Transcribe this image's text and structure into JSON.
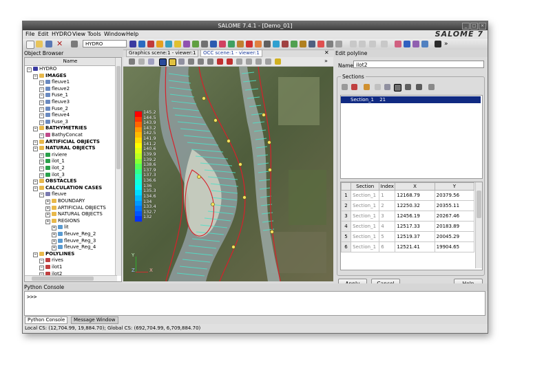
{
  "window": {
    "title": "SALOME 7.4.1 - [Demo_01]",
    "brand": "SALOME 7",
    "win_buttons": [
      "_",
      "□",
      "×"
    ]
  },
  "menubar": {
    "items": [
      "File",
      "Edit",
      "HYDRO",
      "View",
      "Tools",
      "Window",
      "Help"
    ]
  },
  "toolbar": {
    "module_combo": "HYDRO"
  },
  "object_browser": {
    "title": "Object Browser",
    "column_header": "Name",
    "tree": [
      {
        "label": "HYDRO",
        "depth": 0,
        "bold": false,
        "icon": "hydro-root-icon"
      },
      {
        "label": "IMAGES",
        "depth": 1,
        "bold": true,
        "icon": "folder-icon"
      },
      {
        "label": "fleuve1",
        "depth": 2,
        "bold": false,
        "icon": "image-icon"
      },
      {
        "label": "fleuve2",
        "depth": 2,
        "bold": false,
        "icon": "image-icon"
      },
      {
        "label": "Fuse_1",
        "depth": 2,
        "bold": false,
        "icon": "image-icon"
      },
      {
        "label": "fleuve3",
        "depth": 2,
        "bold": false,
        "icon": "image-icon"
      },
      {
        "label": "Fuse_2",
        "depth": 2,
        "bold": false,
        "icon": "image-icon"
      },
      {
        "label": "fleuve4",
        "depth": 2,
        "bold": false,
        "icon": "image-icon"
      },
      {
        "label": "Fuse_3",
        "depth": 2,
        "bold": false,
        "icon": "image-icon"
      },
      {
        "label": "BATHYMETRIES",
        "depth": 1,
        "bold": true,
        "icon": "folder-icon"
      },
      {
        "label": "BathyConcat",
        "depth": 2,
        "bold": false,
        "icon": "bathymetry-icon"
      },
      {
        "label": "ARTIFICIAL OBJECTS",
        "depth": 1,
        "bold": true,
        "icon": "folder-icon"
      },
      {
        "label": "NATURAL OBJECTS",
        "depth": 1,
        "bold": true,
        "icon": "folder-icon"
      },
      {
        "label": "riviere",
        "depth": 2,
        "bold": false,
        "icon": "natural-object-icon"
      },
      {
        "label": "ilot_1",
        "depth": 2,
        "bold": false,
        "icon": "natural-object-icon"
      },
      {
        "label": "ilot_2",
        "depth": 2,
        "bold": false,
        "icon": "natural-object-icon"
      },
      {
        "label": "ilot_3",
        "depth": 2,
        "bold": false,
        "icon": "natural-object-icon"
      },
      {
        "label": "OBSTACLES",
        "depth": 1,
        "bold": true,
        "icon": "folder-icon"
      },
      {
        "label": "CALCULATION CASES",
        "depth": 1,
        "bold": true,
        "icon": "folder-icon"
      },
      {
        "label": "fleuve",
        "depth": 2,
        "bold": false,
        "icon": "calc-case-icon"
      },
      {
        "label": "BOUNDARY",
        "depth": 3,
        "bold": false,
        "icon": "folder-icon"
      },
      {
        "label": "ARTIFICIAL OBJECTS",
        "depth": 3,
        "bold": false,
        "icon": "folder-icon"
      },
      {
        "label": "NATURAL OBJECTS",
        "depth": 3,
        "bold": false,
        "icon": "folder-icon"
      },
      {
        "label": "REGIONS",
        "depth": 3,
        "bold": false,
        "icon": "folder-icon"
      },
      {
        "label": "lit",
        "depth": 4,
        "bold": false,
        "icon": "region-icon"
      },
      {
        "label": "fleuve_Reg_2",
        "depth": 4,
        "bold": false,
        "icon": "region-icon"
      },
      {
        "label": "fleuve_Reg_3",
        "depth": 4,
        "bold": false,
        "icon": "region-icon"
      },
      {
        "label": "fleuve_Reg_4",
        "depth": 4,
        "bold": false,
        "icon": "region-icon"
      },
      {
        "label": "POLYLINES",
        "depth": 1,
        "bold": true,
        "icon": "folder-icon"
      },
      {
        "label": "rives",
        "depth": 2,
        "bold": false,
        "icon": "polyline-icon"
      },
      {
        "label": "ilot1",
        "depth": 2,
        "bold": false,
        "icon": "polyline-icon"
      },
      {
        "label": "ilot2",
        "depth": 2,
        "bold": false,
        "icon": "polyline-icon"
      }
    ]
  },
  "viewer": {
    "tabs": [
      "Graphics scene:1 - viewer:1",
      "OCC scene:1 - viewer:1"
    ],
    "active_tab": 1,
    "axis_labels": [
      "Y",
      "Z",
      "X"
    ],
    "color_scale": {
      "values": [
        "145.2",
        "144.5",
        "143.9",
        "143.2",
        "142.5",
        "141.9",
        "141.2",
        "140.6",
        "139.9",
        "139.2",
        "138.6",
        "137.9",
        "137.3",
        "136.6",
        "136",
        "135.3",
        "134.6",
        "134",
        "133.4",
        "132.7",
        "132"
      ],
      "colors": [
        "#ff0000",
        "#ff3300",
        "#ff6600",
        "#ff9900",
        "#ffbb00",
        "#ffdd00",
        "#ffff00",
        "#ddff11",
        "#bbff22",
        "#88ff33",
        "#55ff55",
        "#33ff88",
        "#22ffbb",
        "#11ffdd",
        "#00ffff",
        "#00ddff",
        "#00bbff",
        "#0099ff",
        "#0077ff",
        "#0055ff",
        "#0033ff"
      ]
    }
  },
  "edit_polyline": {
    "title": "Edit polyline",
    "name_label": "Name",
    "name_value": "ilot2",
    "sections_label": "Sections",
    "section_list": [
      {
        "name": "Section_1",
        "count": "21"
      }
    ],
    "table": {
      "headers": [
        "Section",
        "Index",
        "X",
        "Y"
      ],
      "rows": [
        [
          "1",
          "Section_1",
          "1",
          "12168.79",
          "20379.56"
        ],
        [
          "2",
          "Section_1",
          "2",
          "12250.32",
          "20355.11"
        ],
        [
          "3",
          "Section_1",
          "3",
          "12456.19",
          "20267.46"
        ],
        [
          "4",
          "Section_1",
          "4",
          "12517.33",
          "20183.89"
        ],
        [
          "5",
          "Section_1",
          "5",
          "12519.37",
          "20045.29"
        ],
        [
          "6",
          "Section_1",
          "6",
          "12521.41",
          "19904.65"
        ]
      ]
    },
    "buttons": {
      "apply": "Apply",
      "cancel": "Cancel",
      "help": "Help"
    }
  },
  "python_console": {
    "title": "Python Console",
    "prompt": ">>>",
    "tabs": [
      "Python Console",
      "Message Window"
    ]
  },
  "statusbar": {
    "text": "Local CS: (12,704.99, 19,884.70); Global CS: (692,704.99, 6,709,884.70)"
  }
}
